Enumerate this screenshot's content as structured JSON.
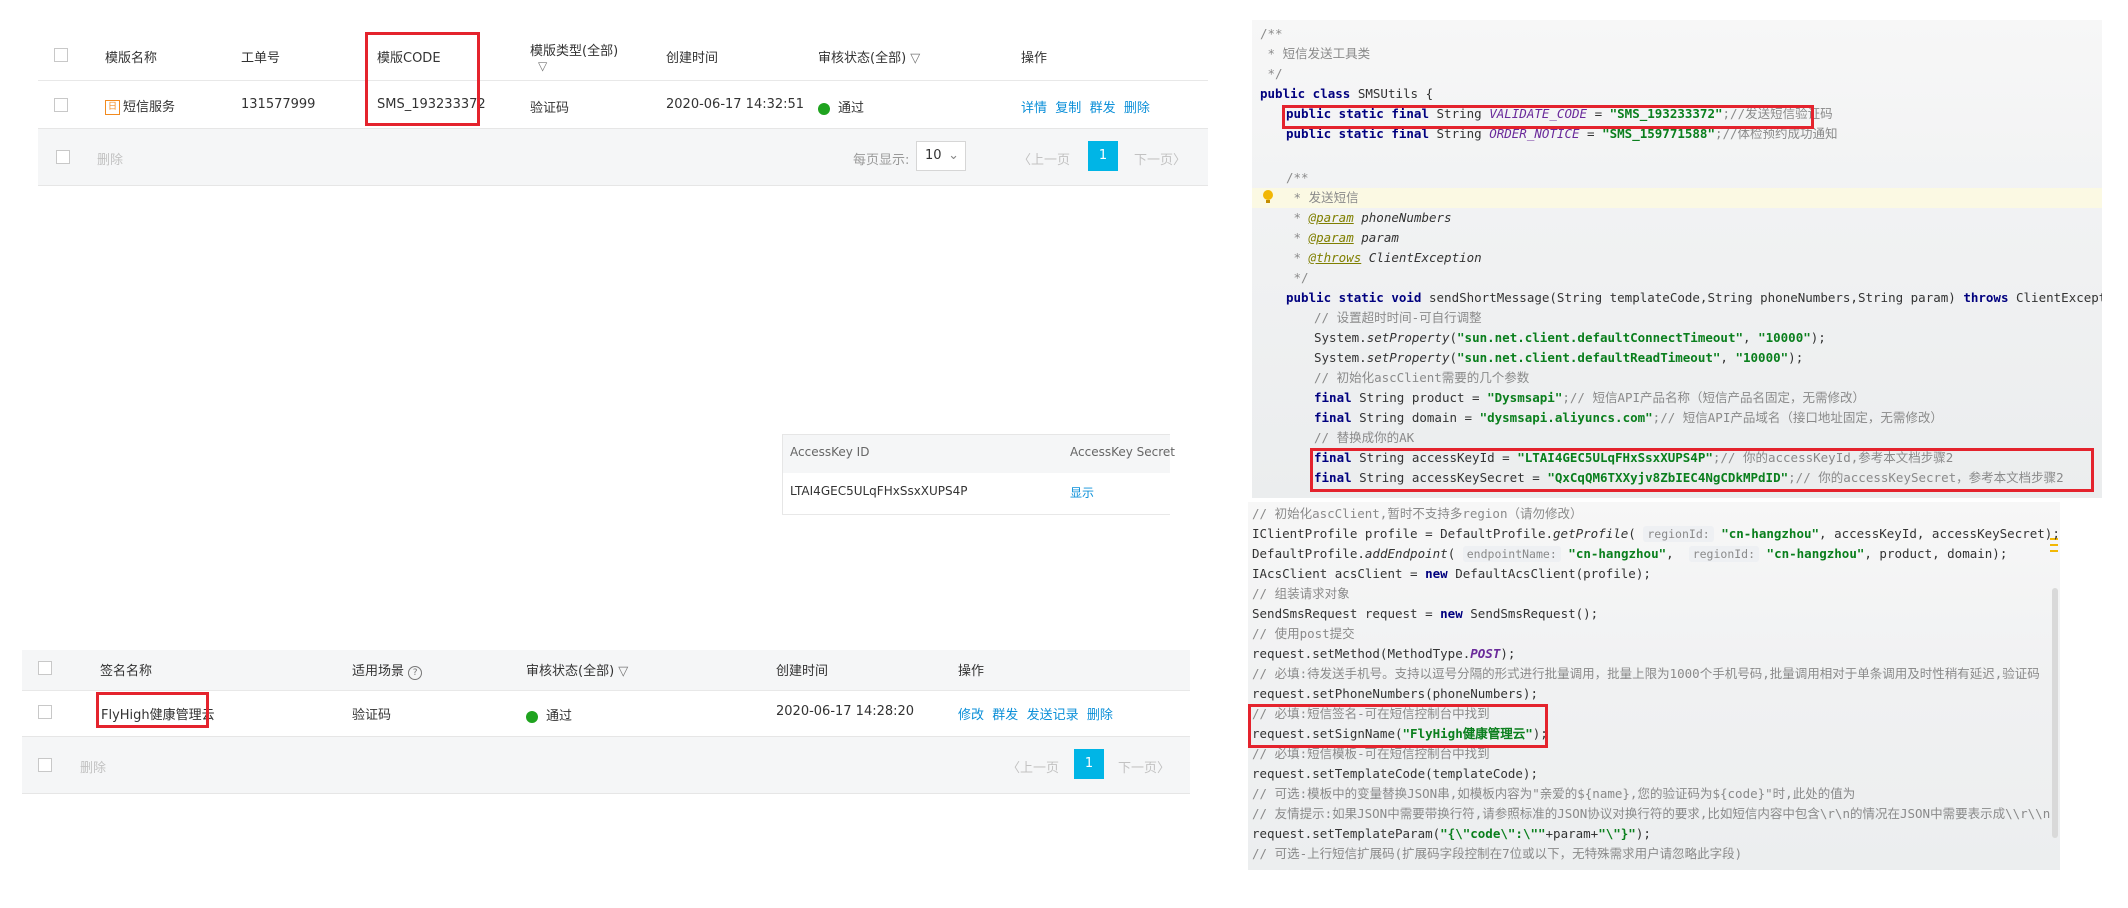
{
  "template_table": {
    "headers": [
      "模版名称",
      "工单号",
      "模版CODE",
      "模版类型(全部)",
      "创建时间",
      "审核状态(全部)",
      "操作"
    ],
    "row": {
      "name": "短信服务",
      "ticket": "131577999",
      "code": "SMS_193233372",
      "type": "验证码",
      "created": "2020-06-17 14:32:51",
      "status": "通过",
      "actions": [
        "详情",
        "复制",
        "群发",
        "删除"
      ]
    },
    "footer": {
      "delete": "删除",
      "per_page_label": "每页显示:",
      "per_page_value": "10",
      "prev": "上一页",
      "page": "1",
      "next": "下一页"
    }
  },
  "accesskey_table": {
    "headers": [
      "AccessKey ID",
      "AccessKey Secret"
    ],
    "id": "LTAI4GEC5ULqFHxSsxXUPS4P",
    "show": "显示"
  },
  "sign_table": {
    "headers": [
      "签名名称",
      "适用场景",
      "审核状态(全部)",
      "创建时间",
      "操作"
    ],
    "row": {
      "name": "FlyHigh健康管理云",
      "scene": "验证码",
      "status": "通过",
      "created": "2020-06-17 14:28:20",
      "actions": [
        "修改",
        "群发",
        "发送记录",
        "删除"
      ]
    },
    "footer": {
      "delete": "删除",
      "prev": "上一页",
      "page": "1",
      "next": "下一页"
    }
  },
  "code_top": {
    "l1": "/**",
    "l2": " * 短信发送工具类",
    "l3": " */",
    "l4a": "public class ",
    "l4b": "SMSUtils {",
    "l5a": "public static final ",
    "l5b": "String ",
    "l5c": "VALIDATE_CODE",
    "l5d": " = ",
    "l5e": "\"SMS_193233372\"",
    "l5f": ";//发送短信验证码",
    "l6a": "public static final ",
    "l6b": "String ",
    "l6c": "ORDER_NOTICE",
    "l6d": " = ",
    "l6e": "\"SMS_159771588\"",
    "l6f": ";//体检预约成功通知",
    "l8": "/**",
    "l9": " * 发送短信",
    "l10a": " * ",
    "l10b": "@param",
    "l10c": " phoneNumbers",
    "l11a": " * ",
    "l11b": "@param",
    "l11c": " param",
    "l12a": " * ",
    "l12b": "@throws",
    "l12c": " ClientException",
    "l13": " */",
    "l14a": "public static void ",
    "l14b": "sendShortMessage(String templateCode,String phoneNumbers,String param) ",
    "l14c": "throws",
    "l14d": " ClientException {",
    "l15": "// 设置超时时间-可自行调整",
    "l16a": "System.",
    "l16b": "setProperty",
    "l16c": "(",
    "l16d": "\"sun.net.client.defaultConnectTimeout\"",
    "l16e": ", ",
    "l16f": "\"10000\"",
    "l16g": ");",
    "l17a": "System.",
    "l17b": "setProperty",
    "l17c": "(",
    "l17d": "\"sun.net.client.defaultReadTimeout\"",
    "l17e": ", ",
    "l17f": "\"10000\"",
    "l17g": ");",
    "l18": "// 初始化ascClient需要的几个参数",
    "l19a": "final ",
    "l19b": "String product = ",
    "l19c": "\"Dysmsapi\"",
    "l19d": ";// 短信API产品名称（短信产品名固定，无需修改）",
    "l20a": "final ",
    "l20b": "String domain = ",
    "l20c": "\"dysmsapi.aliyuncs.com\"",
    "l20d": ";// 短信API产品域名（接口地址固定，无需修改）",
    "l21": "// 替换成你的AK",
    "l22a": "final ",
    "l22b": "String accessKeyId = ",
    "l22c": "\"LTAI4GEC5ULqFHxSsxXUPS4P\"",
    "l22d": ";// 你的accessKeyId,参考本文档步骤2",
    "l23a": "final ",
    "l23b": "String accessKeySecret = ",
    "l23c": "\"QxCqQM6TXXyjv8ZbIEC4NgCDkMPdID\"",
    "l23d": ";// 你的accessKeySecret，参考本文档步骤2"
  },
  "code_bottom": {
    "b1": "// 初始化ascClient,暂时不支持多region（请勿修改）",
    "b2a": "IClientProfile profile = DefaultProfile.",
    "b2b": "getProfile",
    "b2c": "( ",
    "b2h": "regionId:",
    "b2d": " \"cn-hangzhou\"",
    "b2e": ", accessKeyId, accessKeySecret);",
    "b3a": "DefaultProfile.",
    "b3b": "addEndpoint",
    "b3c": "( ",
    "b3h1": "endpointName:",
    "b3d": " \"cn-hangzhou\"",
    "b3e": ",  ",
    "b3h2": "regionId:",
    "b3f": " \"cn-hangzhou\"",
    "b3g": ", product, domain);",
    "b4a": "IAcsClient acsClient = ",
    "b4b": "new ",
    "b4c": "DefaultAcsClient(profile);",
    "b5": "// 组装请求对象",
    "b6a": "SendSmsRequest request = ",
    "b6b": "new ",
    "b6c": "SendSmsRequest();",
    "b7": "// 使用post提交",
    "b8a": "request.setMethod(MethodType.",
    "b8b": "POST",
    "b8c": ");",
    "b9": "// 必填:待发送手机号。支持以逗号分隔的形式进行批量调用，批量上限为1000个手机号码,批量调用相对于单条调用及时性稍有延迟,验证码",
    "b10": "request.setPhoneNumbers(phoneNumbers);",
    "b11": "// 必填:短信签名-可在短信控制台中找到",
    "b12a": "request.setSignName(",
    "b12b": "\"FlyHigh健康管理云\"",
    "b12c": ");",
    "b13": "// 必填:短信模板-可在短信控制台中找到",
    "b14": "request.setTemplateCode(templateCode);",
    "b15": "// 可选:模板中的变量替换JSON串,如模板内容为\"亲爱的${name},您的验证码为${code}\"时,此处的值为",
    "b16": "// 友情提示:如果JSON中需要带换行符,请参照标准的JSON协议对换行符的要求,比如短信内容中包含\\r\\n的情况在JSON中需要表示成\\\\r\\\\n",
    "b17a": "request.setTemplateParam(",
    "b17b": "\"{\\\"code\\\":\\\"\"",
    "b17c": "+param+",
    "b17d": "\"\\\"}\"",
    "b17e": ");",
    "b18": "// 可选-上行短信扩展码(扩展码字段控制在7位或以下，无特殊需求用户请忽略此字段)"
  },
  "colors": {
    "accent": "#00b5e6",
    "link": "#0b8fd8",
    "highlight_border": "#e4232d",
    "status_pass": "#1fa31f",
    "code_keyword": "#00007f",
    "code_string": "#0a7f1d",
    "code_comment": "#8a8a8a"
  }
}
